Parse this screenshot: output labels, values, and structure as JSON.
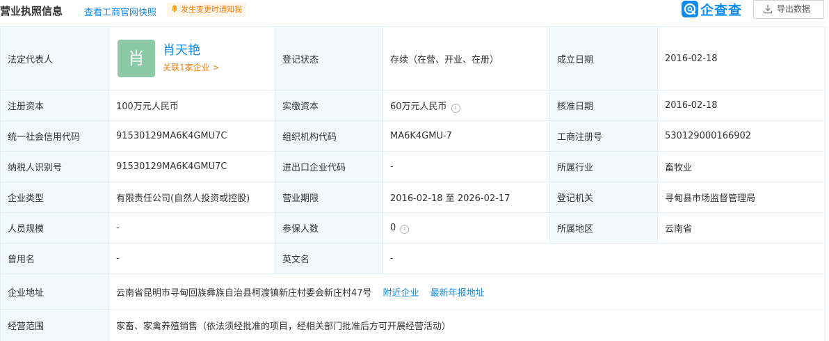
{
  "header": {
    "title": "营业执照信息",
    "snapshot_link": "查看工商官网快照",
    "notify_label": "发生变更时通知我",
    "brand": "企查查",
    "export_label": "导出数据"
  },
  "colors": {
    "accent": "#128bed",
    "warn": "#f27e10",
    "label_bg": "#f2f9fc",
    "avatar_bg": "#8bcaa5"
  },
  "legal_rep": {
    "label": "法定代表人",
    "avatar_char": "肖",
    "name": "肖天艳",
    "related": "关联1家企业 >"
  },
  "rows": {
    "reg_status": {
      "label": "登记状态",
      "value": "存续（在营、开业、在册）"
    },
    "found_date": {
      "label": "成立日期",
      "value": "2016-02-18"
    },
    "reg_capital": {
      "label": "注册资本",
      "value": "100万元人民币"
    },
    "paid_capital": {
      "label": "实缴资本",
      "value": "60万元人民币"
    },
    "approve_date": {
      "label": "核准日期",
      "value": "2016-02-18"
    },
    "credit_code": {
      "label": "统一社会信用代码",
      "value": "91530129MA6K4GMU7C"
    },
    "org_code": {
      "label": "组织机构代码",
      "value": "MA6K4GMU-7"
    },
    "biz_reg_no": {
      "label": "工商注册号",
      "value": "530129000166902"
    },
    "taxpayer_id": {
      "label": "纳税人识别号",
      "value": "91530129MA6K4GMU7C"
    },
    "import_export_code": {
      "label": "进出口企业代码",
      "value": "-"
    },
    "industry": {
      "label": "所属行业",
      "value": "畜牧业"
    },
    "company_type": {
      "label": "企业类型",
      "value": "有限责任公司(自然人投资或控股)"
    },
    "biz_term": {
      "label": "营业期限",
      "value": "2016-02-18 至 2026-02-17"
    },
    "reg_authority": {
      "label": "登记机关",
      "value": "寻甸县市场监督管理局"
    },
    "staff_size": {
      "label": "人员规模",
      "value": "-"
    },
    "insured_count": {
      "label": "参保人数",
      "value": "0"
    },
    "region": {
      "label": "所属地区",
      "value": "云南省"
    },
    "former_name": {
      "label": "曾用名",
      "value": "-"
    },
    "english_name": {
      "label": "英文名",
      "value": "-"
    },
    "address": {
      "label": "企业地址",
      "value": "云南省昆明市寻甸回族彝族自治县柯渡镇新庄村委会新庄村47号",
      "nearby_link": "附近企业",
      "annual_link": "最新年报地址"
    },
    "scope": {
      "label": "经营范围",
      "value": "家畜、家禽养殖销售（依法须经批准的项目，经相关部门批准后方可开展经营活动）"
    }
  },
  "info_icon": "info-circle-icon"
}
